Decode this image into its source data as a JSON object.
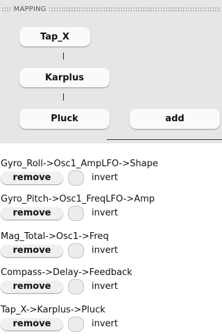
{
  "header": {
    "title": ":::: MAPPING :::::::::::::::::::::::::::::::::::::::::::::::::::::::::::::::::::::::::::::::::::::::::::::::::::::::::::::::::::::::"
  },
  "chain": {
    "nodes": [
      "Tap_X",
      "Karplus",
      "Pluck"
    ],
    "add_label": "add"
  },
  "routes": [
    {
      "label": "Gyro_Roll->Osc1_AmpLFO->Shape",
      "remove": "remove",
      "invert": "invert"
    },
    {
      "label": "Gyro_Pitch->Osc1_FreqLFO->Amp",
      "remove": "remove",
      "invert": "invert"
    },
    {
      "label": "Mag_Total->Osc1->Freq",
      "remove": "remove",
      "invert": "invert"
    },
    {
      "label": "Compass->Delay->Feedback",
      "remove": "remove",
      "invert": "invert"
    },
    {
      "label": "Tap_X->Karplus->Pluck",
      "remove": "remove",
      "invert": "invert"
    }
  ]
}
